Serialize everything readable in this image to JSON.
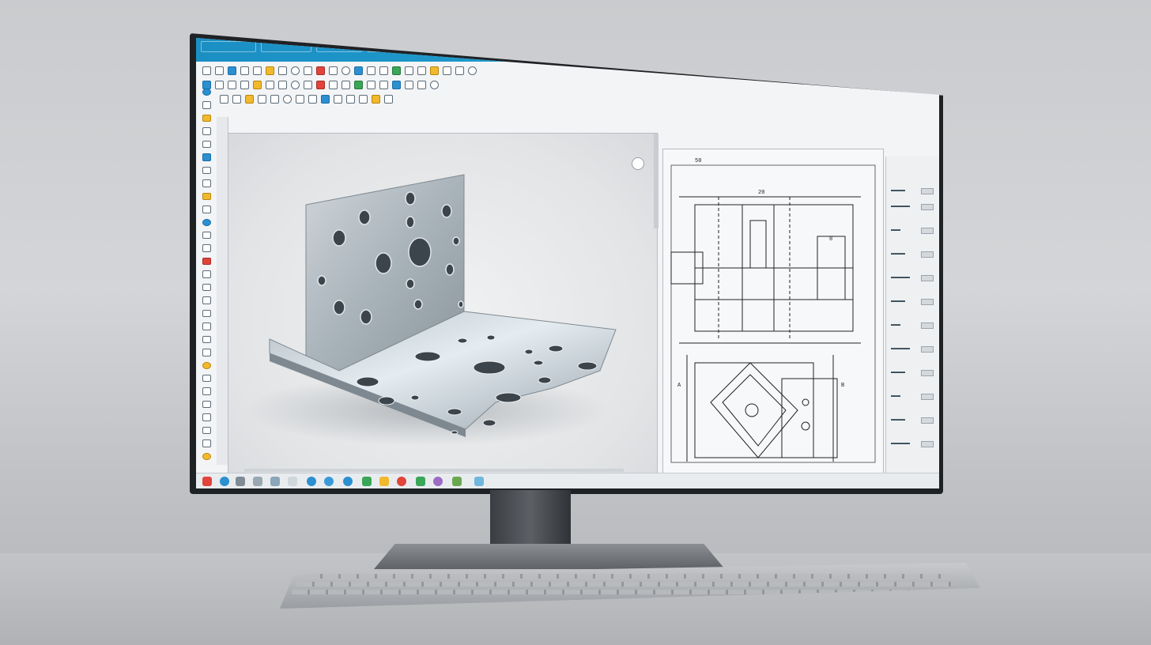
{
  "titlebar": {
    "tabs": [
      "",
      "",
      "",
      ""
    ]
  },
  "status": {
    "text": ""
  },
  "colors": {
    "accent": "#1b8fc4",
    "metal": "#aab4bc",
    "drawing_line": "#222"
  },
  "icons": {
    "viewcube": "view-cube-icon",
    "start": "windows-start-icon"
  }
}
